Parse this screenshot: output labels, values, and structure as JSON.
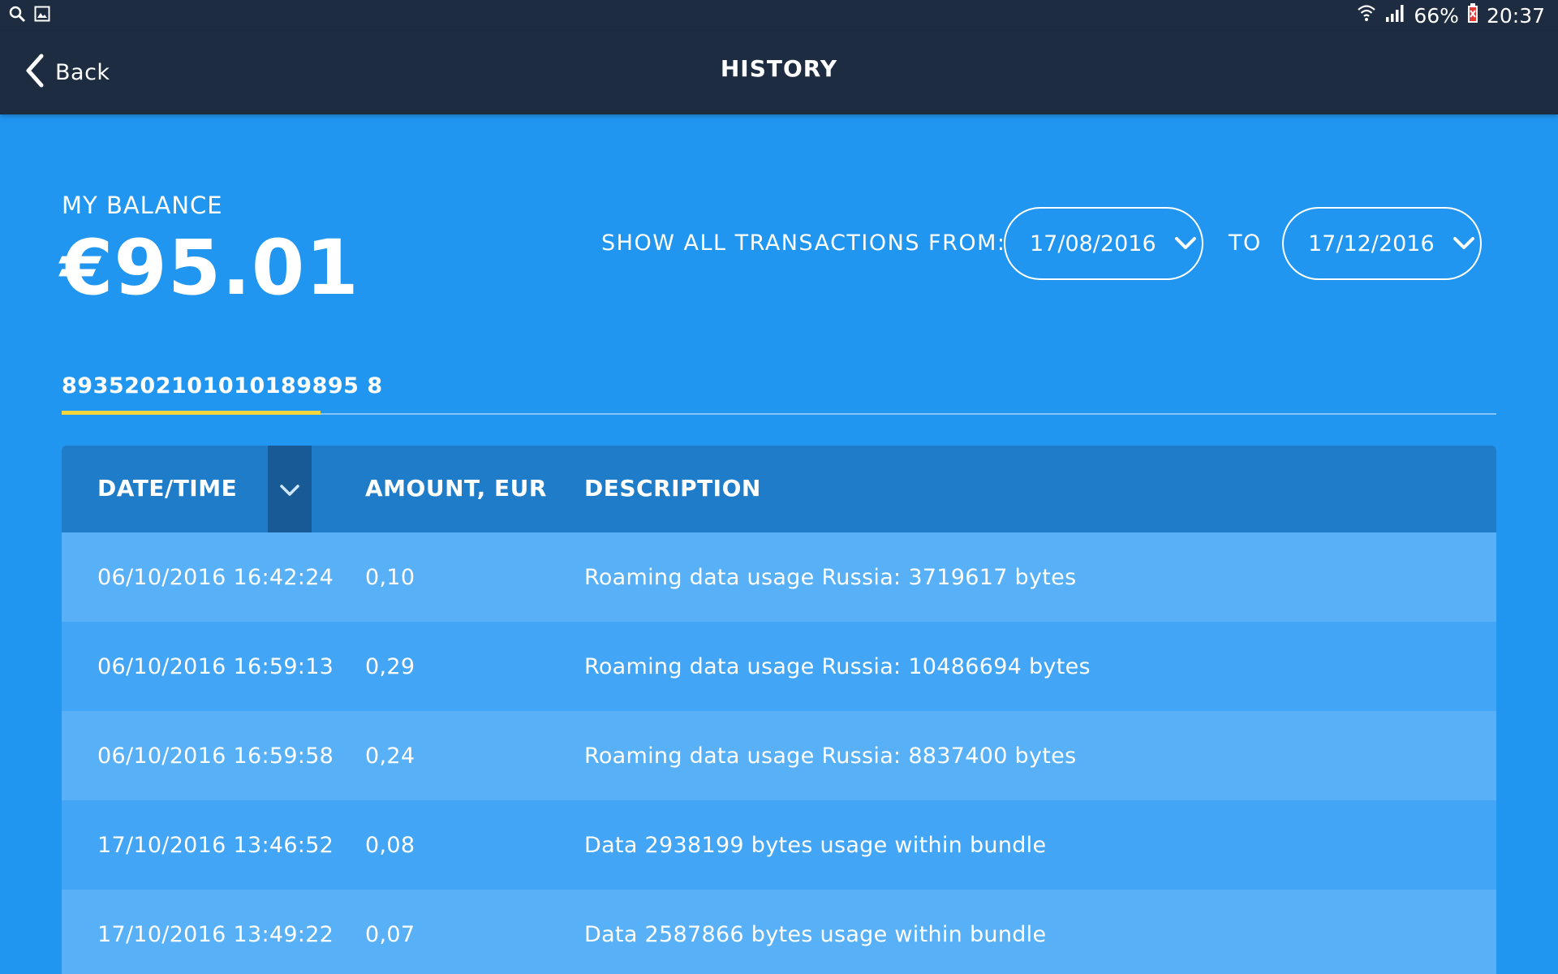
{
  "status_bar": {
    "battery": "66%",
    "time": "20:37"
  },
  "header": {
    "back_label": "Back",
    "title": "HISTORY"
  },
  "balance": {
    "label": "MY BALANCE",
    "value": "€95.01"
  },
  "filter": {
    "label": "SHOW ALL TRANSACTIONS FROM:",
    "from_date": "17/08/2016",
    "to_label": "TO",
    "to_date": "17/12/2016"
  },
  "tab": {
    "label": "8935202101010189895 8"
  },
  "table": {
    "columns": [
      "DATE/TIME",
      "AMOUNT, EUR",
      "DESCRIPTION"
    ],
    "rows": [
      {
        "datetime": "06/10/2016 16:42:24",
        "amount": "0,10",
        "description": "Roaming data usage Russia: 3719617 bytes"
      },
      {
        "datetime": "06/10/2016 16:59:13",
        "amount": "0,29",
        "description": "Roaming data usage Russia: 10486694 bytes"
      },
      {
        "datetime": "06/10/2016 16:59:58",
        "amount": "0,24",
        "description": "Roaming data usage Russia: 8837400 bytes"
      },
      {
        "datetime": "17/10/2016 13:46:52",
        "amount": "0,08",
        "description": "Data 2938199 bytes usage within bundle"
      },
      {
        "datetime": "17/10/2016 13:49:22",
        "amount": "0,07",
        "description": "Data 2587866 bytes usage within bundle"
      }
    ]
  },
  "colors": {
    "background": "#2196f0",
    "header": "#1d2c40",
    "accent_underline": "#f3d53d",
    "table_header": "#1f7cc8"
  },
  "icons": [
    "search-icon",
    "image-icon",
    "wifi-icon",
    "signal-icon",
    "battery-icon",
    "chevron-left-icon",
    "chevron-down-icon"
  ]
}
